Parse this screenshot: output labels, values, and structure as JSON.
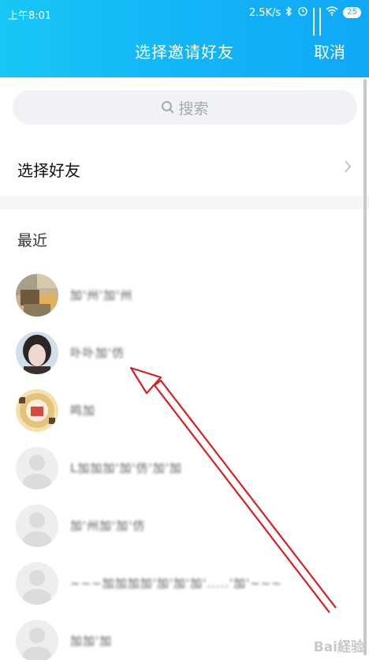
{
  "status": {
    "time": "上午8:01",
    "speed": "2.5K/s",
    "battery": "25",
    "icons": [
      "bluetooth-icon",
      "alarm-icon",
      "signal-icon",
      "signal-icon",
      "wifi-icon",
      "battery-icon"
    ]
  },
  "header": {
    "title": "选择邀请好友",
    "cancel": "取消",
    "color_start": "#17c6f6",
    "color_end": "#10a8f5"
  },
  "search": {
    "placeholder": "搜索"
  },
  "select_friends": {
    "label": "选择好友"
  },
  "recent": {
    "label": "最近"
  },
  "contacts": [
    {
      "name": "加'州'加'州",
      "avatar": "photo-food"
    },
    {
      "name": "卟卟加'仿",
      "avatar": "photo-girl"
    },
    {
      "name": "鸣加",
      "avatar": "photo-cartoon"
    },
    {
      "name": "L加加加'加'仿'加'加",
      "avatar": "default-gray"
    },
    {
      "name": "加'州加'加'仿",
      "avatar": "default-gray"
    },
    {
      "name": "~~~加加加加'加'加'加'.....'加'~~~",
      "avatar": "default-gray"
    },
    {
      "name": "加加'加",
      "avatar": "default-gray"
    }
  ],
  "annotation": {
    "arrow_color": "#d42020"
  },
  "watermark": "Bai経验"
}
